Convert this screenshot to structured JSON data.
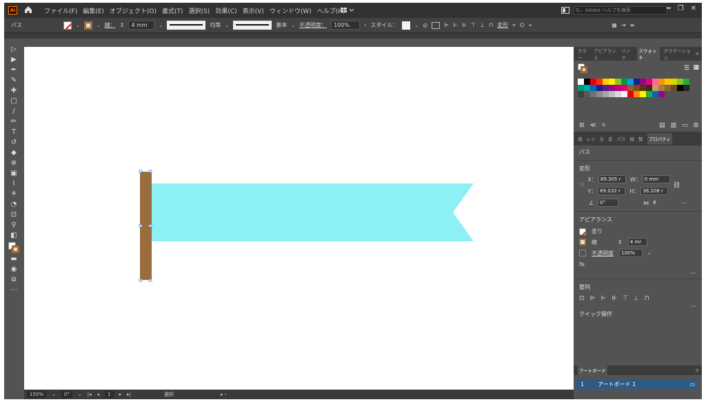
{
  "app": {
    "logo": "Ai"
  },
  "menu": {
    "items": [
      "ファイル(F)",
      "編集(E)",
      "オブジェクト(O)",
      "書式(T)",
      "選択(S)",
      "効果(C)",
      "表示(V)",
      "ウィンドウ(W)",
      "ヘルプ(H)"
    ]
  },
  "search": {
    "placeholder": "Adobe ヘルプを検索"
  },
  "control": {
    "mode_label": "パス",
    "stroke_label": "線：",
    "stroke_width": "4 mm",
    "profile_label": "均等",
    "brush_label": "基本",
    "opacity_label": "不透明度：",
    "opacity_value": "100%",
    "style_label": "スタイル：",
    "transform_label": "変形"
  },
  "swatch_colors": [
    "#ffffff",
    "#000000",
    "#e60012",
    "#ff3300",
    "#ffcc00",
    "#fff100",
    "#8fc31f",
    "#009944",
    "#00a0e9",
    "#1d2088",
    "#920783",
    "#e4007f",
    "#ff6699",
    "#f39800",
    "#fcc800",
    "#cfdb00",
    "#8fc31f",
    "#22ac38",
    "#009b6b",
    "#00a4ac",
    "#0068b7",
    "#1d2088",
    "#601986",
    "#920783",
    "#be0081",
    "#e5006a",
    "#9c5b2b",
    "#7d4a1c",
    "#5a3214",
    "#3f2c1c",
    "#c8a063",
    "#a67c52",
    "#8c6239",
    "#6b4a2b",
    "#000000",
    "#262626",
    "#404040",
    "#595959",
    "#737373",
    "#8c8c8c",
    "#a6a6a6",
    "#bfbfbf",
    "#d9d9d9",
    "#f2f2f2",
    "#e60012",
    "#ff8c00",
    "#fff100",
    "#22ac38",
    "#0068b7",
    "#920783"
  ],
  "panel": {
    "tabs_top": [
      "カラー",
      "アピアランス",
      "リンク",
      "スウォッチ",
      "グラデーション"
    ],
    "tabs_bottom": [
      "透",
      "レイ",
      "文",
      "変",
      "パス",
      "線",
      "整",
      "プロパティ"
    ],
    "path_title": "パス",
    "transform_title": "変形",
    "x_label": "X：",
    "x_value": "89.305 r",
    "y_label": "Y：",
    "y_value": "69.032 r",
    "w_label": "W：",
    "w_value": "0 mm",
    "h_label": "H：",
    "h_value": "36.208 r",
    "angle_value": "0°",
    "appearance_title": "アピアランス",
    "fill_label": "塗り",
    "stroke_label": "線",
    "stroke_value": "4 mr",
    "opacity_label": "不透明度",
    "opacity_value": "100%",
    "fx_label": "fx.",
    "align_title": "整列",
    "quick_title": "クイック操作",
    "artboard_tab": "アートボード",
    "artboard_index": "1",
    "artboard_name": "アートボード 1"
  },
  "status": {
    "zoom": "150%",
    "rotation": "0°",
    "artboard_nav": "1",
    "mode": "選択"
  },
  "colors": {
    "ribbon": "#8cf0f4",
    "pole": "#9a6d3c",
    "ui_dark": "#323232",
    "ui_mid": "#535353"
  }
}
